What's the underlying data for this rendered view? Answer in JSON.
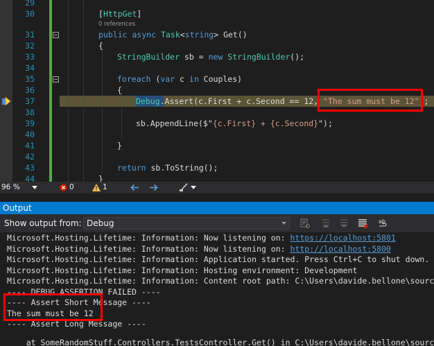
{
  "editor": {
    "line_numbers": [
      "29",
      "30",
      "31",
      "32",
      "33",
      "34",
      "35",
      "36",
      "37",
      "38",
      "39",
      "40",
      "41",
      "42",
      "43",
      "44"
    ],
    "references_label": "0 references",
    "code": {
      "l30": {
        "p1": "[",
        "attr": "HttpGet",
        "p2": "]"
      },
      "l31": {
        "kw1": "public",
        "kw2": "async",
        "ty1": "Task",
        "p1": "<",
        "kw3": "string",
        "p2": "> Get()"
      },
      "l32": "{",
      "l33": {
        "ty1": "StringBuilder",
        "p1": " sb = ",
        "kw1": "new",
        "ty2": "StringBuilder",
        "p2": "();"
      },
      "l35": {
        "kw1": "foreach",
        "p1": " (",
        "kw2": "var",
        "p2": " c ",
        "kw3": "in",
        "p3": " Couples)"
      },
      "l36": "{",
      "l37": {
        "id": "Debug",
        "p1": ".Assert(c.First + c.Second == 12, ",
        "st": "\"The sum must be 12\"",
        "p2": "); "
      },
      "l38": {
        "p1": "sb.AppendLine($\"",
        "p2": "{c.First} + {c.Second}",
        "p3": "\");"
      },
      "l40": "}",
      "l42": {
        "kw1": "return",
        "p1": " sb.ToString();"
      },
      "l43": "}"
    }
  },
  "status_bar": {
    "zoom": "96 %",
    "errors": "0",
    "warnings": "1"
  },
  "output": {
    "title": "Output",
    "show_from_label": "Show output from:",
    "source": "Debug",
    "lines": [
      {
        "text": "Microsoft.Hosting.Lifetime: Information: Now listening on: ",
        "link": "https://localhost:5801"
      },
      {
        "text": "Microsoft.Hosting.Lifetime: Information: Now listening on: ",
        "link": "http://localhost:5800"
      },
      {
        "text": "Microsoft.Hosting.Lifetime: Information: Application started. Press Ctrl+C to shut down."
      },
      {
        "text": "Microsoft.Hosting.Lifetime: Information: Hosting environment: Development"
      },
      {
        "text": "Microsoft.Hosting.Lifetime: Information: Content root path: C:\\Users\\davide.bellone\\source"
      },
      {
        "text": "---- DEBUG ASSERTION FAILED ----"
      },
      {
        "text": "---- Assert Short Message ----"
      },
      {
        "text": "The sum must be 12"
      },
      {
        "text": "---- Assert Long Message ----"
      },
      {
        "text": ""
      },
      {
        "text": "    at SomeRandomStuff.Controllers.TestsController.Get() in C:\\Users\\davide.bellone\\source"
      }
    ]
  },
  "colors": {
    "accent": "#007acc",
    "highlight_box": "#ff0000",
    "exec_line": "#5c5436",
    "change_bar": "#57a64a"
  }
}
